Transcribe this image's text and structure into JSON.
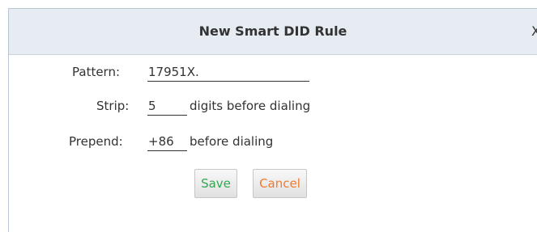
{
  "dialog": {
    "title": "New Smart DID Rule",
    "close_glyph": "X"
  },
  "form": {
    "pattern_label": "Pattern:",
    "pattern_value": "17951X.",
    "strip_label": "Strip:",
    "strip_value": "5",
    "strip_suffix": "digits before dialing",
    "prepend_label": "Prepend:",
    "prepend_value": "+86",
    "prepend_suffix": "before dialing"
  },
  "buttons": {
    "save_label": "Save",
    "cancel_label": "Cancel"
  },
  "colors": {
    "title_bar": "#e6ecf2",
    "save_text": "#2fa84f",
    "cancel_text": "#f07b2d"
  }
}
